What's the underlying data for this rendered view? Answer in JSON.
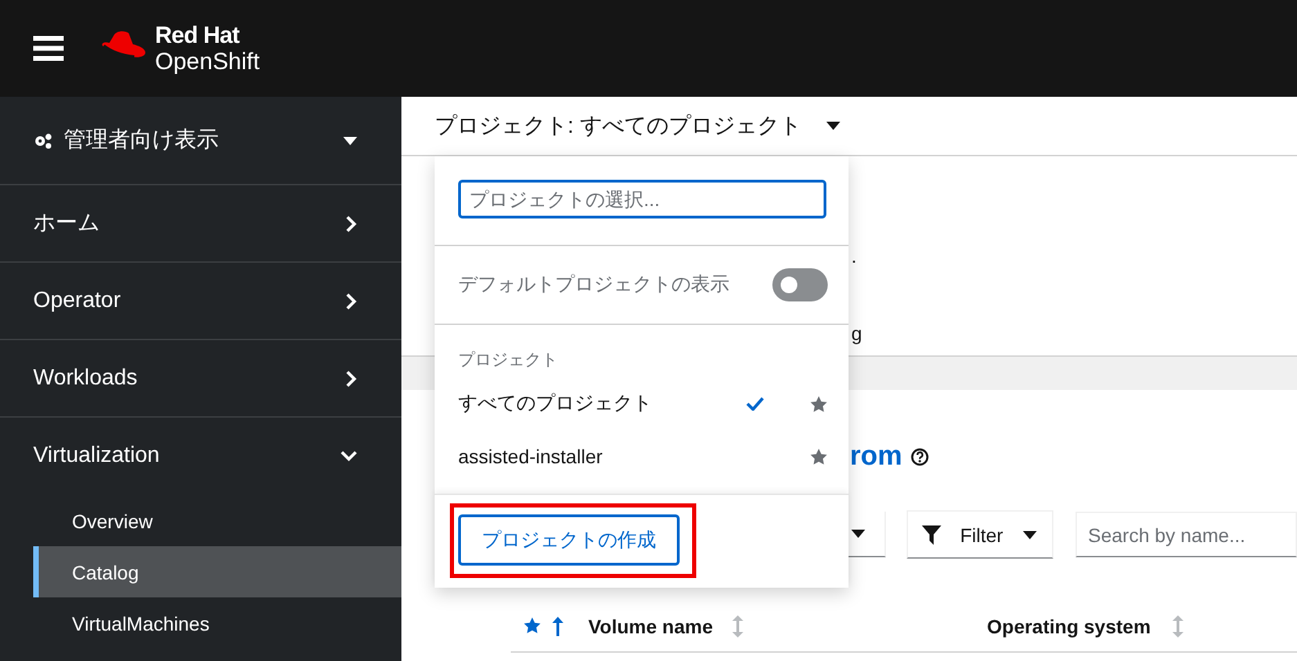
{
  "header": {
    "brand_line1": "Red Hat",
    "brand_line2": "OpenShift"
  },
  "sidebar": {
    "perspective": "管理者向け表示",
    "items": [
      {
        "label": "ホーム",
        "expanded": false
      },
      {
        "label": "Operator",
        "expanded": false
      },
      {
        "label": "Workloads",
        "expanded": false
      },
      {
        "label": "Virtualization",
        "expanded": true,
        "children": [
          {
            "label": "Overview",
            "selected": false
          },
          {
            "label": "Catalog",
            "selected": true
          },
          {
            "label": "VirtualMachines",
            "selected": false
          }
        ]
      }
    ]
  },
  "project_bar": {
    "label": "プロジェクト: すべてのプロジェクト"
  },
  "background": {
    "text_lines": [
      ".",
      "g"
    ],
    "heading": "rom",
    "filter_button": "Filter",
    "search": {
      "placeholder": "Search by name..."
    },
    "table": {
      "columns": [
        "Volume name",
        "Operating system"
      ]
    }
  },
  "project_menu": {
    "search": {
      "placeholder": "プロジェクトの選択..."
    },
    "default_toggle": {
      "label": "デフォルトプロジェクトの表示",
      "on": false
    },
    "group_label": "プロジェクト",
    "projects": [
      {
        "name": "すべてのプロジェクト",
        "selected": true
      },
      {
        "name": "assisted-installer",
        "selected": false
      }
    ],
    "create_button": "プロジェクトの作成"
  }
}
